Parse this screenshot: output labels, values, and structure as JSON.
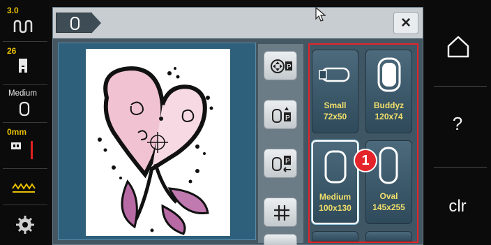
{
  "status": {
    "stitch_width_value": "3.0",
    "stitch_length_value": "26",
    "hoop_label": "Medium",
    "offset_value": "0mm"
  },
  "window": {
    "close_label": "×"
  },
  "hoops": [
    {
      "name": "Small",
      "size": "72x50",
      "icon": "small-hoop-icon"
    },
    {
      "name": "Buddyz",
      "size": "120x74",
      "icon": "buddyz-hoop-icon"
    },
    {
      "name": "Medium",
      "size": "100x130",
      "icon": "medium-hoop-icon",
      "selected": true
    },
    {
      "name": "Oval",
      "size": "145x255",
      "icon": "oval-hoop-icon"
    }
  ],
  "annotation_badge": "1",
  "right_nav": {
    "help_label": "?",
    "clear_label": "clr"
  },
  "colors": {
    "highlight": "#e4242a",
    "hoop_text": "#f2df6a",
    "value_text": "#e8c000"
  }
}
